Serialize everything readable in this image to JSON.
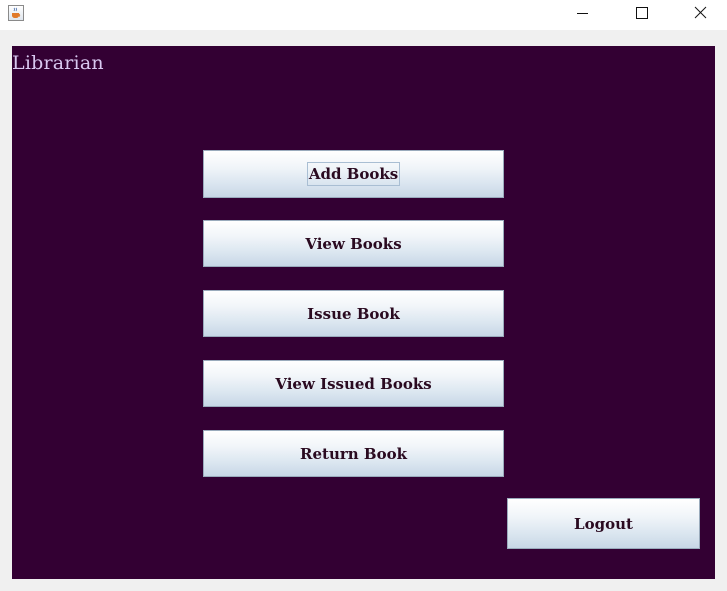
{
  "window": {
    "icon": "java-cup-icon",
    "controls": [
      "minimize-icon",
      "maximize-icon",
      "close-icon"
    ]
  },
  "panel": {
    "background": "#330033",
    "heading": "Librarian",
    "heading_color": "#d8c8f0"
  },
  "menu": {
    "add_books": "Add Books",
    "view_books": "View Books",
    "issue_book": "Issue Book",
    "view_issued_books": "View Issued Books",
    "return_book": "Return Book",
    "logout": "Logout"
  }
}
